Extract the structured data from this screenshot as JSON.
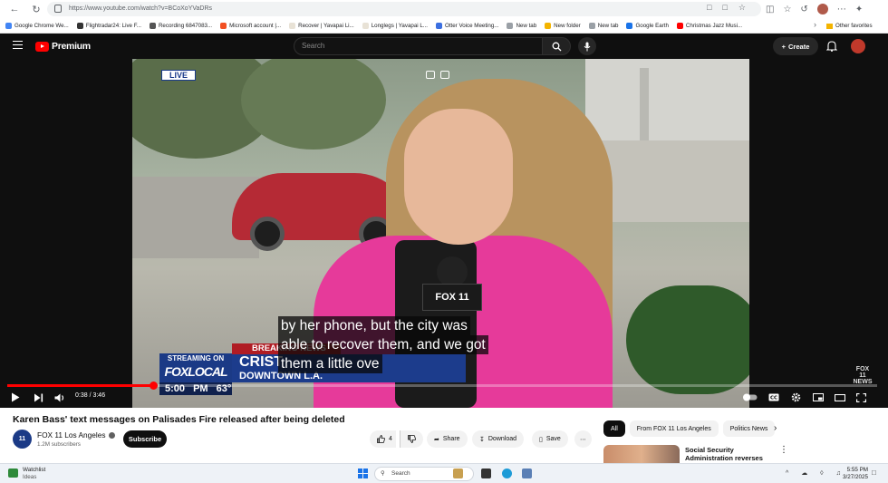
{
  "browser": {
    "url": "https://www.youtube.com/watch?v=BCoXoYVaDRs",
    "bookmarks": [
      {
        "label": "Google Chrome We...",
        "color": "#4285f4"
      },
      {
        "label": "Flightradar24: Live F...",
        "color": "#333333"
      },
      {
        "label": "Recording 6847083...",
        "color": "#555555"
      },
      {
        "label": "Microsoft account |...",
        "color": "#f25022"
      },
      {
        "label": "Recover | Yavapai Li...",
        "color": "#e8e2d6"
      },
      {
        "label": "Longlegs | Yavapai L...",
        "color": "#e8e2d6"
      },
      {
        "label": "Otter Voice Meeting...",
        "color": "#3b6fe0"
      },
      {
        "label": "New tab",
        "color": "#9aa0a6"
      },
      {
        "label": "New folder",
        "color": "#f4b400"
      },
      {
        "label": "New tab",
        "color": "#9aa0a6"
      },
      {
        "label": "Google Earth",
        "color": "#1a73e8"
      },
      {
        "label": "Christmas Jazz Musi...",
        "color": "#ff0000"
      }
    ],
    "other_favorites": "Other favorites"
  },
  "youtube_header": {
    "logo_text": "Premium",
    "search_placeholder": "Search",
    "create_label": "Create"
  },
  "video": {
    "live_badge": "LIVE",
    "caption_lines": [
      "by her phone, but the city was",
      "able to recover them, and we got",
      "them a little ove"
    ],
    "lower_third": {
      "streaming_line1": "STREAMING ON",
      "streaming_line2": "FOXLOCAL",
      "breaking": "BREAKING NEWS",
      "name": "CRIST",
      "location": "DOWNTOWN L.A.",
      "time": "5:00 PM",
      "temp": "63°"
    },
    "bug": "FOX 11 NEWS",
    "time_display": "0:38 / 3:46",
    "progress_fraction": 0.168
  },
  "video_info": {
    "title": "Karen Bass' text messages on Palisades Fire released after being deleted",
    "channel_name": "FOX 11 Los Angeles",
    "channel_avatar_text": "11",
    "subscribers": "1.2M subscribers",
    "subscribe_label": "Subscribe",
    "like_count": "4",
    "share_label": "Share",
    "download_label": "Download",
    "save_label": "Save"
  },
  "sidebar": {
    "chips": [
      "All",
      "From FOX 11 Los Angeles",
      "Politics News"
    ],
    "recommendation_title": "Social Security Administration reverses certain ID"
  },
  "taskbar": {
    "widget_title": "Watchlist",
    "widget_sub": "Ideas",
    "search_placeholder": "Search",
    "time": "5:55 PM",
    "date": "3/27/2025"
  }
}
